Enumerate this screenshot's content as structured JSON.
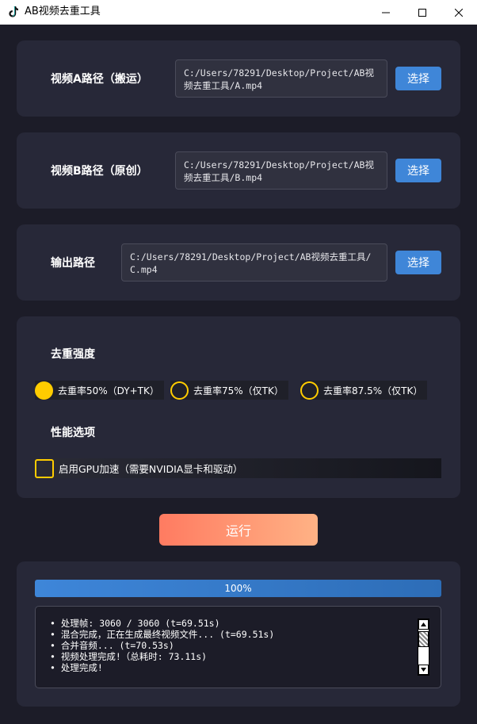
{
  "window": {
    "title": "AB视频去重工具"
  },
  "paths": [
    {
      "label": "视频A路径（搬运）",
      "value": "C:/Users/78291/Desktop/Project/AB视频去重工具/A.mp4",
      "button": "选择"
    },
    {
      "label": "视频B路径（原创）",
      "value": "C:/Users/78291/Desktop/Project/AB视频去重工具/B.mp4",
      "button": "选择"
    },
    {
      "label": "输出路径",
      "value": "C:/Users/78291/Desktop/Project/AB视频去重工具/C.mp4",
      "button": "选择"
    }
  ],
  "options": {
    "strength_title": "去重强度",
    "strength": [
      {
        "label": "去重率50%（DY+TK）",
        "selected": true
      },
      {
        "label": "去重率75%（仅TK）",
        "selected": false
      },
      {
        "label": "去重率87.5%（仅TK）",
        "selected": false
      }
    ],
    "perf_title": "性能选项",
    "gpu_label": "启用GPU加速（需要NVIDIA显卡和驱动）",
    "gpu_checked": false
  },
  "run_label": "运行",
  "progress": {
    "value": 1.0,
    "label": "100%"
  },
  "log": [
    "• 处理帧: 3060 / 3060 (t=69.51s)",
    "• 混合完成，正在生成最终视频文件... (t=69.51s)",
    "• 合并音频... (t=70.53s)",
    "• 视频处理完成!（总耗时: 73.11s)",
    "• 处理完成!"
  ],
  "colors": {
    "accent": "#3f86d8",
    "radio": "#ffcc00",
    "run_start": "#ff7b61",
    "run_end": "#ffb285",
    "bg": "#1c1c28",
    "panel": "#272838"
  },
  "icons": {
    "app": "tiktok-icon",
    "minimize": "minimize-icon",
    "maximize": "maximize-icon",
    "close": "close-icon"
  }
}
